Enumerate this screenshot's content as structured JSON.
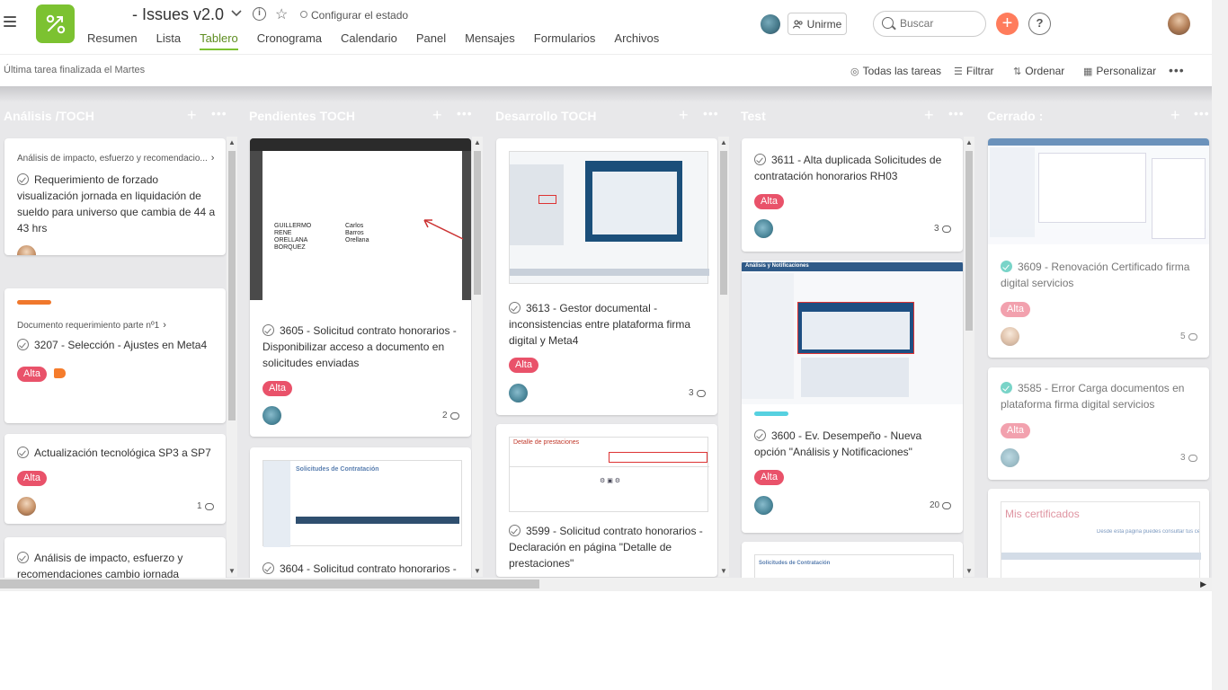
{
  "header": {
    "project_title": "- Issues v2.0",
    "status_label": "Configurar el estado",
    "tabs": [
      "Resumen",
      "Lista",
      "Tablero",
      "Cronograma",
      "Calendario",
      "Panel",
      "Mensajes",
      "Formularios",
      "Archivos"
    ],
    "active_tab": "Tablero",
    "join_label": "Unirme",
    "search_placeholder": "Buscar",
    "add_symbol": "+",
    "help_symbol": "?"
  },
  "subbar": {
    "last_task": "Última tarea finalizada el Martes",
    "all_tasks": "Todas las tareas",
    "filter": "Filtrar",
    "sort": "Ordenar",
    "customize": "Personalizar"
  },
  "columns": [
    {
      "title": "Análisis        /TOCH"
    },
    {
      "title": "Pendientes TOCH"
    },
    {
      "title": "Desarrollo TOCH"
    },
    {
      "title": "Test"
    },
    {
      "title": "Cerrado :"
    }
  ],
  "cards": {
    "c1": {
      "parent": "Análisis de impacto, esfuerzo y recomendacio...",
      "title": "Requerimiento de forzado visualización jornada en liquidación de sueldo para universo que cambia de 44 a 43 hrs"
    },
    "c2": {
      "parent": "Documento requerimiento parte nº1",
      "title": "3207 - Selección - Ajustes en Meta4",
      "badge": "Alta"
    },
    "c3": {
      "title": "Actualización tecnológica SP3 a SP7",
      "badge": "Alta",
      "comments": "1"
    },
    "c4": {
      "title": "Análisis de impacto, esfuerzo y recomendaciones cambio jornada"
    },
    "p1": {
      "title": "3605 - Solicitud contrato honorarios - Disponibilizar acceso a documento en solicitudes enviadas",
      "badge": "Alta",
      "comments": "2"
    },
    "p2": {
      "title": "3604 - Solicitud contrato honorarios -"
    },
    "d1": {
      "title": "3613 - Gestor documental - inconsistencias entre plataforma firma digital y Meta4",
      "badge": "Alta",
      "comments": "3"
    },
    "d2": {
      "title": "3599 - Solicitud contrato honorarios - Declaración en página \"Detalle de prestaciones\""
    },
    "t1": {
      "title": "3611 - Alta duplicada Solicitudes de contratación honorarios RH03",
      "badge": "Alta",
      "comments": "3"
    },
    "t2": {
      "title": "3600 - Ev. Desempeño - Nueva opción \"Análisis y Notificaciones\"",
      "badge": "Alta",
      "comments": "20"
    },
    "z1": {
      "title": "3609 - Renovación Certificado firma digital servicios",
      "badge": "Alta",
      "comments": "5"
    },
    "z2": {
      "title": "3585 - Error Carga documentos en plataforma firma digital servicios",
      "badge": "Alta",
      "comments": "3"
    }
  },
  "screenshot_text": {
    "doc_name_left": "GUILLERMO RENE ORELLANA BORQUEZ",
    "doc_name_right": "Carlos Barros Orellana",
    "solicitudes": "Solicitudes de Contratación",
    "detalle": "Detalle de prestaciones",
    "analisis": "Análisis y Notificaciones",
    "mis_certificados": "Mis certificados",
    "cert_subtitle": "Desde esta página puedes consultar tus ce"
  },
  "colors": {
    "accent": "#7cc231",
    "badge": "#e9526a",
    "add": "#ff7c5c"
  }
}
